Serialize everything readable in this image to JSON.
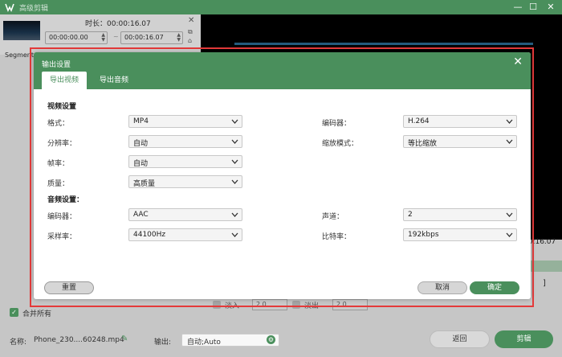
{
  "app": {
    "title": "高级剪辑"
  },
  "colors": {
    "accent": "#4a8f5c",
    "highlight_frame": "#e43a3a"
  },
  "segment_panel": {
    "duration_label": "时长：00:00:16.07",
    "start_time": "00:00:00.00",
    "end_time": "00:00:16.07",
    "separator": "~",
    "segment_name": "Segment 1",
    "close_icon": "close-icon"
  },
  "preview": {
    "time_readout": "00:16.07",
    "bracket": "]"
  },
  "fade": {
    "fade_in_label": "淡入",
    "fade_in_value": "2.0",
    "fade_out_label": "淡出",
    "fade_out_value": "2.0"
  },
  "merge": {
    "label": "合并所有",
    "checked": true
  },
  "bottom": {
    "name_label": "名称:",
    "name_value": "Phone_230....60248.mp4",
    "output_label": "输出:",
    "output_value": "自动;Auto",
    "back_button": "返回",
    "cut_button": "剪辑"
  },
  "dialog": {
    "title": "输出设置",
    "tabs": [
      "导出视频",
      "导出音频"
    ],
    "video_section": "视频设置",
    "audio_section": "音频设置：",
    "video_left": [
      {
        "label": "格式：",
        "value": "MP4"
      },
      {
        "label": "分辨率：",
        "value": "自动"
      },
      {
        "label": "帧率：",
        "value": "自动"
      },
      {
        "label": "质量：",
        "value": "高质量"
      }
    ],
    "video_right": [
      {
        "label": "编码器：",
        "value": "H.264"
      },
      {
        "label": "缩放模式：",
        "value": "等比缩放"
      }
    ],
    "audio_left": [
      {
        "label": "编码器：",
        "value": "AAC"
      },
      {
        "label": "采样率：",
        "value": "44100Hz"
      }
    ],
    "audio_right": [
      {
        "label": "声道：",
        "value": "2"
      },
      {
        "label": "比特率：",
        "value": "192kbps"
      }
    ],
    "reset_button": "重置",
    "cancel_button": "取消",
    "ok_button": "确定"
  }
}
